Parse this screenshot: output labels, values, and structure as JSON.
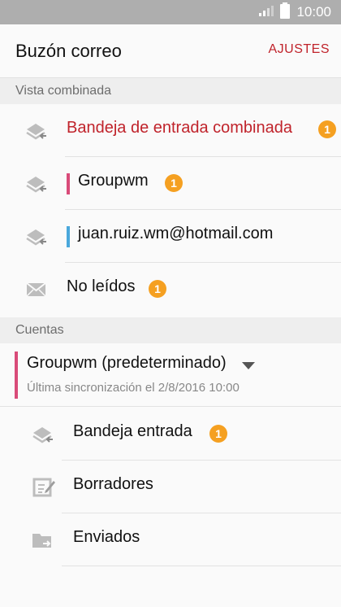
{
  "status_bar": {
    "time": "10:00",
    "icons": [
      "signal-icon",
      "battery-icon"
    ]
  },
  "app_bar": {
    "title": "Buzón correo",
    "action_label": "AJUSTES",
    "action_color": "#c0232b"
  },
  "sections": {
    "combined_header": "Vista combinada",
    "accounts_header": "Cuentas"
  },
  "combined_view": [
    {
      "label": "Bandeja de entrada combinada",
      "badge": "1",
      "icon": "inbox-stack-icon",
      "label_color": "#c0232b"
    },
    {
      "label": "Groupwm",
      "badge": "1",
      "icon": "inbox-stack-icon",
      "accent": "#d94b79"
    },
    {
      "label": "juan.ruiz.wm@hotmail.com",
      "icon": "inbox-stack-icon",
      "accent": "#4aa8dc"
    },
    {
      "label": "No leídos",
      "badge": "1",
      "icon": "envelope-icon"
    }
  ],
  "account": {
    "name": "Groupwm (predeterminado)",
    "sync_text": "Última sincronización el 2/8/2016 10:00",
    "accent": "#d94b79",
    "folders": [
      {
        "label": "Bandeja entrada",
        "badge": "1",
        "icon": "inbox-stack-icon"
      },
      {
        "label": "Borradores",
        "icon": "draft-edit-icon"
      },
      {
        "label": "Enviados",
        "icon": "sent-folder-icon"
      }
    ]
  },
  "colors": {
    "badge": "#f5a021",
    "status_bar": "#aeaeae",
    "section_header_bg": "#eeeeee"
  }
}
